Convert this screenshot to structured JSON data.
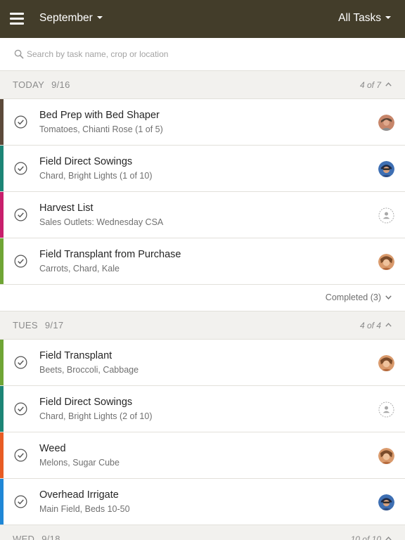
{
  "header": {
    "month": "September",
    "filter": "All Tasks"
  },
  "search": {
    "placeholder": "Search by task name, crop or location"
  },
  "colors": {
    "brown": "#5c4a3a",
    "teal": "#1c8576",
    "magenta": "#c81f6c",
    "green": "#6fa535",
    "orange": "#e85c24",
    "blue": "#1f87d6",
    "topbar": "#433d2a"
  },
  "days": [
    {
      "label": "TODAY",
      "date": "9/16",
      "count": "4 of 7",
      "tasks": [
        {
          "title": "Bed Prep with Bed Shaper",
          "sub": "Tomatoes, Chianti Rose (1 of 5)",
          "color": "#5c4a3a",
          "avatar": "person-a"
        },
        {
          "title": "Field Direct Sowings",
          "sub": "Chard, Bright Lights (1 of 10)",
          "color": "#1c8576",
          "avatar": "person-b"
        },
        {
          "title": "Harvest List",
          "sub": "Sales Outlets: Wednesday CSA",
          "color": "#c81f6c",
          "avatar": "unassigned"
        },
        {
          "title": "Field Transplant from Purchase",
          "sub": "Carrots, Chard, Kale",
          "color": "#6fa535",
          "avatar": "person-c"
        }
      ],
      "completed": "Completed (3)"
    },
    {
      "label": "TUES",
      "date": "9/17",
      "count": "4 of 4",
      "tasks": [
        {
          "title": "Field Transplant",
          "sub": "Beets, Broccoli, Cabbage",
          "color": "#6fa535",
          "avatar": "person-c"
        },
        {
          "title": "Field Direct Sowings",
          "sub": "Chard, Bright Lights (2 of 10)",
          "color": "#1c8576",
          "avatar": "unassigned"
        },
        {
          "title": "Weed",
          "sub": "Melons, Sugar Cube",
          "color": "#e85c24",
          "avatar": "person-c"
        },
        {
          "title": "Overhead Irrigate",
          "sub": "Main Field, Beds 10-50",
          "color": "#1f87d6",
          "avatar": "person-b"
        }
      ]
    },
    {
      "label": "WED",
      "date": "9/18",
      "count": "10 of 10"
    }
  ]
}
